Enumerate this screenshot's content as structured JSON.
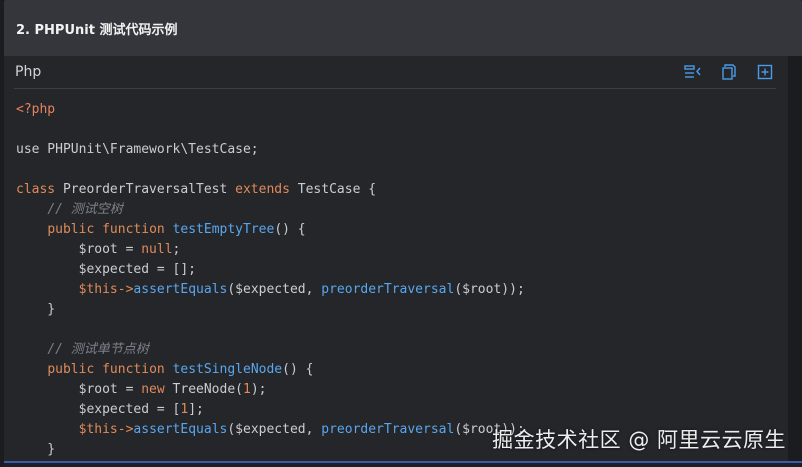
{
  "section": {
    "title": "2. PHPUnit 测试代码示例"
  },
  "code_block": {
    "language": "Php",
    "toolbar": {
      "format_icon": "format-lines-icon",
      "copy_icon": "copy-icon",
      "expand_icon": "expand-icon"
    },
    "lines": [
      [
        {
          "t": "tag",
          "v": "<?php"
        }
      ],
      [],
      [
        {
          "t": "plain",
          "v": "use PHPUnit\\Framework\\TestCase;"
        }
      ],
      [],
      [
        {
          "t": "kw",
          "v": "class"
        },
        {
          "t": "plain",
          "v": " PreorderTraversalTest "
        },
        {
          "t": "kw",
          "v": "extends"
        },
        {
          "t": "plain",
          "v": " TestCase {"
        }
      ],
      [
        {
          "t": "plain",
          "v": "    "
        },
        {
          "t": "comment",
          "v": "// 测试空树"
        }
      ],
      [
        {
          "t": "plain",
          "v": "    "
        },
        {
          "t": "kw",
          "v": "public"
        },
        {
          "t": "plain",
          "v": " "
        },
        {
          "t": "kw",
          "v": "function"
        },
        {
          "t": "plain",
          "v": " "
        },
        {
          "t": "fn",
          "v": "testEmptyTree"
        },
        {
          "t": "plain",
          "v": "() {"
        }
      ],
      [
        {
          "t": "plain",
          "v": "        $root = "
        },
        {
          "t": "kw",
          "v": "null"
        },
        {
          "t": "plain",
          "v": ";"
        }
      ],
      [
        {
          "t": "plain",
          "v": "        $expected = [];"
        }
      ],
      [
        {
          "t": "plain",
          "v": "        "
        },
        {
          "t": "this",
          "v": "$this"
        },
        {
          "t": "kw",
          "v": "->"
        },
        {
          "t": "fn",
          "v": "assertEquals"
        },
        {
          "t": "plain",
          "v": "($expected, "
        },
        {
          "t": "fn",
          "v": "preorderTraversal"
        },
        {
          "t": "plain",
          "v": "($root));"
        }
      ],
      [
        {
          "t": "plain",
          "v": "    }"
        }
      ],
      [],
      [
        {
          "t": "plain",
          "v": "    "
        },
        {
          "t": "comment",
          "v": "// 测试单节点树"
        }
      ],
      [
        {
          "t": "plain",
          "v": "    "
        },
        {
          "t": "kw",
          "v": "public"
        },
        {
          "t": "plain",
          "v": " "
        },
        {
          "t": "kw",
          "v": "function"
        },
        {
          "t": "plain",
          "v": " "
        },
        {
          "t": "fn",
          "v": "testSingleNode"
        },
        {
          "t": "plain",
          "v": "() {"
        }
      ],
      [
        {
          "t": "plain",
          "v": "        $root = "
        },
        {
          "t": "kw",
          "v": "new"
        },
        {
          "t": "plain",
          "v": " TreeNode("
        },
        {
          "t": "num",
          "v": "1"
        },
        {
          "t": "plain",
          "v": ");"
        }
      ],
      [
        {
          "t": "plain",
          "v": "        $expected = ["
        },
        {
          "t": "num",
          "v": "1"
        },
        {
          "t": "plain",
          "v": "];"
        }
      ],
      [
        {
          "t": "plain",
          "v": "        "
        },
        {
          "t": "this",
          "v": "$this"
        },
        {
          "t": "kw",
          "v": "->"
        },
        {
          "t": "fn",
          "v": "assertEquals"
        },
        {
          "t": "plain",
          "v": "($expected, "
        },
        {
          "t": "fn",
          "v": "preorderTraversal"
        },
        {
          "t": "plain",
          "v": "($root));"
        }
      ],
      [
        {
          "t": "plain",
          "v": "    }"
        }
      ]
    ]
  },
  "watermark": "掘金技术社区 @ 阿里云云原生",
  "colors": {
    "keyword": "#e08a5a",
    "function": "#5aa6ee",
    "comment": "#7c8088",
    "accent": "#5aa6ee"
  }
}
